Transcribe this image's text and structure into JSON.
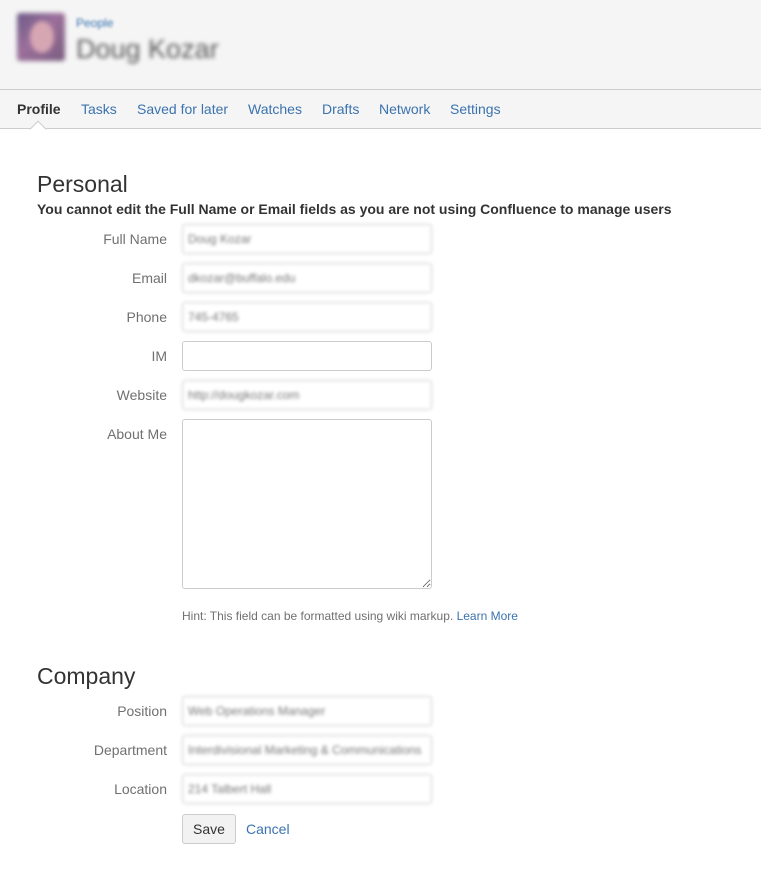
{
  "header": {
    "breadcrumb": "People",
    "user_name": "Doug Kozar",
    "avatar_icon": "user-avatar-photo"
  },
  "tabs": [
    {
      "label": "Profile",
      "active": true
    },
    {
      "label": "Tasks",
      "active": false
    },
    {
      "label": "Saved for later",
      "active": false
    },
    {
      "label": "Watches",
      "active": false
    },
    {
      "label": "Drafts",
      "active": false
    },
    {
      "label": "Network",
      "active": false
    },
    {
      "label": "Settings",
      "active": false
    }
  ],
  "personal": {
    "title": "Personal",
    "warning": "You cannot edit the Full Name or Email fields as you are not using Confluence to manage users",
    "fields": {
      "full_name": {
        "label": "Full Name",
        "value": "Doug Kozar"
      },
      "email": {
        "label": "Email",
        "value": "dkozar@buffalo.edu"
      },
      "phone": {
        "label": "Phone",
        "value": "745-4765"
      },
      "im": {
        "label": "IM",
        "value": ""
      },
      "website": {
        "label": "Website",
        "value": "http://dougkozar.com"
      },
      "about_me": {
        "label": "About Me",
        "value": ""
      }
    },
    "hint": "Hint: This field can be formatted using wiki markup.",
    "hint_link": "Learn More"
  },
  "company": {
    "title": "Company",
    "fields": {
      "position": {
        "label": "Position",
        "value": "Web Operations Manager"
      },
      "department": {
        "label": "Department",
        "value": "Interdivisional Marketing & Communications"
      },
      "location": {
        "label": "Location",
        "value": "214 Talbert Hall"
      }
    }
  },
  "actions": {
    "save_label": "Save",
    "cancel_label": "Cancel"
  },
  "colors": {
    "link": "#3b73af",
    "header_bg": "#f5f5f5",
    "label_text": "#707070"
  }
}
